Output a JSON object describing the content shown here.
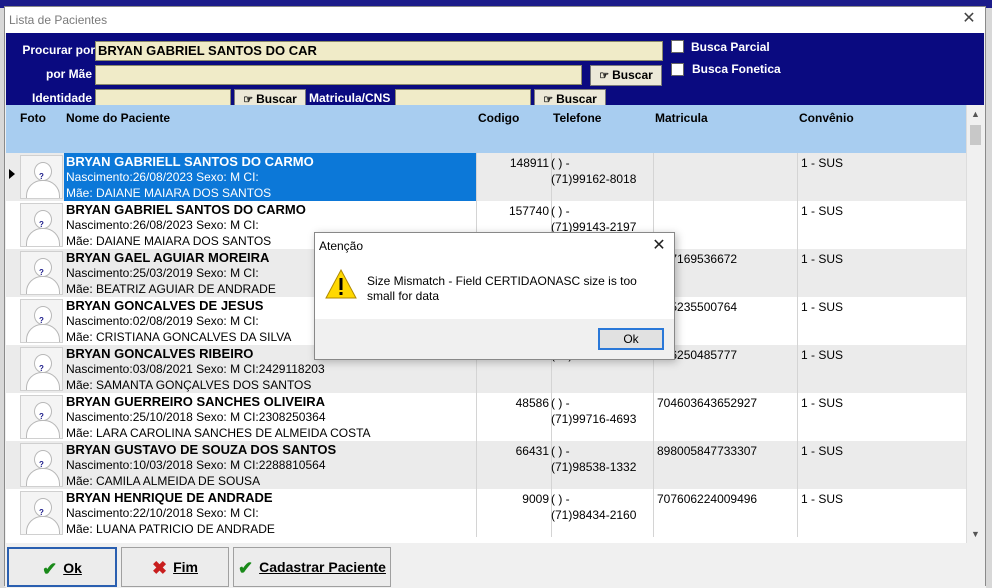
{
  "window": {
    "title": "Lista de Pacientes",
    "close_glyph": "✕"
  },
  "search": {
    "procurar_label": "Procurar por",
    "procurar_value": "BRYAN GABRIEL SANTOS DO CAR",
    "mae_label": "por Mãe",
    "mae_value": "",
    "identidade_label": "Identidade",
    "identidade_value": "",
    "matricula_label": "Matricula/CNS",
    "matricula_value": "",
    "buscar_label": "Buscar",
    "busca_parcial_label": "Busca Parcial",
    "busca_fonetica_label": "Busca Fonetica"
  },
  "grid": {
    "headers": {
      "foto": "Foto",
      "nome": "Nome do Paciente",
      "codigo": "Codigo",
      "telefone": "Telefone",
      "matricula": "Matricula",
      "convenio": "Convênio"
    },
    "rows": [
      {
        "name": "BRYAN GABRIELL SANTOS DO CARMO",
        "nasc": "Nascimento:26/08/2023 Sexo: M CI:",
        "mae": "Mãe: DAIANE MAIARA DOS SANTOS",
        "codigo": "148911",
        "tel1": "(  )     -",
        "tel2": "(71)99162-8018",
        "matricula": "",
        "convenio": "1 - SUS"
      },
      {
        "name": "BRYAN GABRIEL SANTOS DO CARMO",
        "nasc": "Nascimento:26/08/2023 Sexo: M CI:",
        "mae": "Mãe: DAIANE MAIARA DOS SANTOS",
        "codigo": "157740",
        "tel1": "(  )     -",
        "tel2": "(71)99143-2197",
        "matricula": "",
        "convenio": "1 - SUS"
      },
      {
        "name": "BRYAN GAEL AGUIAR MOREIRA",
        "nasc": "Nascimento:25/03/2019 Sexo: M CI:",
        "mae": "Mãe: BEATRIZ AGUIAR DE ANDRADE",
        "codigo": "",
        "tel1": "",
        "tel2": "",
        "matricula": "107169536672",
        "convenio": "1 - SUS"
      },
      {
        "name": "BRYAN GONCALVES DE JESUS",
        "nasc": "Nascimento:02/08/2019 Sexo: M CI:",
        "mae": "Mãe: CRISTIANA GONCALVES DA SILVA",
        "codigo": "",
        "tel1": "",
        "tel2": "",
        "matricula": "405235500764",
        "convenio": "1 - SUS"
      },
      {
        "name": "BRYAN GONCALVES RIBEIRO",
        "nasc": "Nascimento:03/08/2021 Sexo: M CI:2429118203",
        "mae": "Mãe: SAMANTA GONÇALVES DOS SANTOS",
        "codigo": "",
        "tel1": "",
        "tel2": "(71)98649-2520",
        "matricula": "006250485777",
        "convenio": "1 - SUS"
      },
      {
        "name": "BRYAN GUERREIRO SANCHES OLIVEIRA",
        "nasc": "Nascimento:25/10/2018 Sexo: M CI:2308250364",
        "mae": "Mãe: LARA CAROLINA SANCHES DE ALMEIDA COSTA",
        "codigo": "48586",
        "tel1": "(  )     -",
        "tel2": "(71)99716-4693",
        "matricula": "704603643652927",
        "convenio": "1 - SUS"
      },
      {
        "name": "BRYAN GUSTAVO DE SOUZA DOS SANTOS",
        "nasc": "Nascimento:10/03/2018 Sexo: M CI:2288810564",
        "mae": "Mãe: CAMILA ALMEIDA DE SOUSA",
        "codigo": "66431",
        "tel1": "(  )     -",
        "tel2": "(71)98538-1332",
        "matricula": "898005847733307",
        "convenio": "1 - SUS"
      },
      {
        "name": "BRYAN HENRIQUE DE ANDRADE",
        "nasc": "Nascimento:22/10/2018 Sexo: M CI:",
        "mae": "Mãe: LUANA PATRICIO DE ANDRADE",
        "codigo": "9009",
        "tel1": "(  )     -",
        "tel2": "(71)98434-2160",
        "matricula": "707606224009496",
        "convenio": "1 - SUS"
      }
    ]
  },
  "buttons": {
    "ok": "Ok",
    "fim": "Fim",
    "cadastrar": "Cadastrar Paciente"
  },
  "dialog": {
    "title": "Atenção",
    "message": "Size Mismatch - Field CERTIDAONASC size is too small for data",
    "ok": "Ok"
  }
}
